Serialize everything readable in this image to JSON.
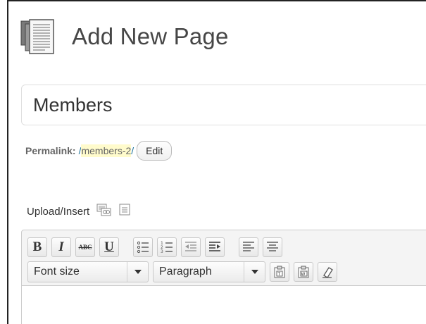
{
  "header": {
    "title": "Add New Page",
    "icon": "pages-icon"
  },
  "title_field": {
    "value": "Members"
  },
  "permalink": {
    "label": "Permalink:",
    "prefix": "/",
    "slug": "members-2",
    "suffix": "/",
    "edit_label": "Edit"
  },
  "media": {
    "label": "Upload/Insert",
    "icons": [
      "add-media-icon",
      "add-image-icon"
    ]
  },
  "toolbar": {
    "row1": [
      {
        "name": "bold-button",
        "text": "B"
      },
      {
        "name": "italic-button",
        "text": "I"
      },
      {
        "name": "strikethrough-button",
        "text": "ABC"
      },
      {
        "name": "underline-button",
        "text": "U"
      },
      {
        "name": "bullet-list-button",
        "icon": "bullet-list-icon"
      },
      {
        "name": "numbered-list-button",
        "icon": "numbered-list-icon"
      },
      {
        "name": "outdent-button",
        "icon": "outdent-icon"
      },
      {
        "name": "indent-button",
        "icon": "indent-icon"
      },
      {
        "name": "align-left-button",
        "icon": "align-left-icon"
      },
      {
        "name": "align-center-button",
        "icon": "align-center-icon"
      }
    ],
    "font_size": "Font size",
    "format": "Paragraph",
    "row2_icons": [
      "paste-text-icon",
      "paste-word-icon",
      "clear-format-icon"
    ]
  }
}
